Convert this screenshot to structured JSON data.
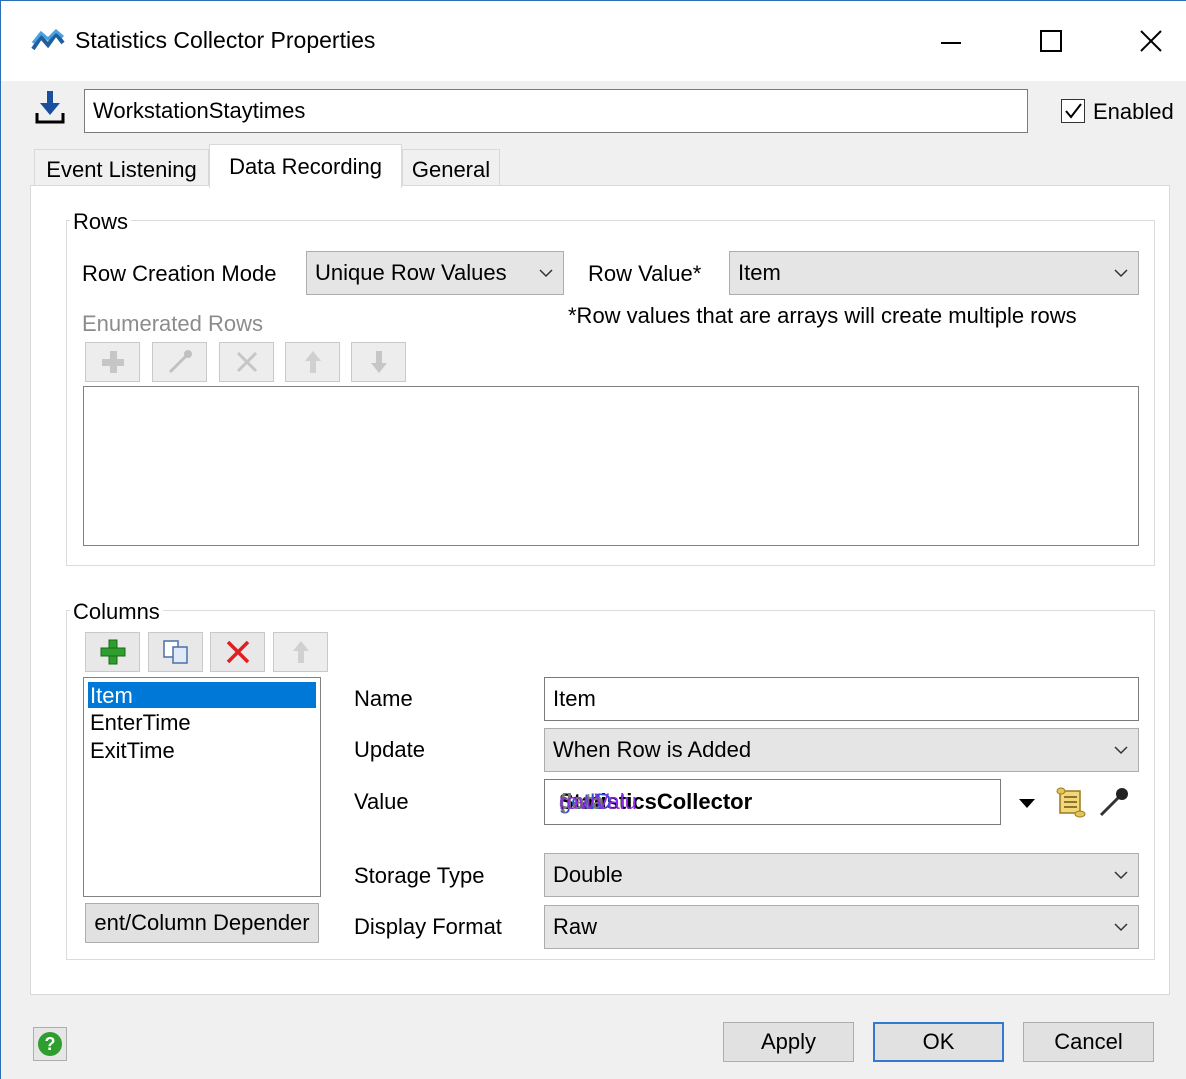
{
  "window": {
    "title": "Statistics Collector Properties",
    "minimize_icon": "minimize-icon",
    "maximize_icon": "maximize-icon",
    "close_icon": "close-icon"
  },
  "header": {
    "object_name": "WorkstationStaytimes",
    "enabled_label": "Enabled",
    "enabled_checked": true
  },
  "tabs": [
    {
      "label": "Event Listening",
      "active": false
    },
    {
      "label": "Data Recording",
      "active": true
    },
    {
      "label": "General",
      "active": false
    }
  ],
  "rows_group": {
    "legend": "Rows",
    "row_creation_mode_label": "Row Creation Mode",
    "row_creation_mode_value": "Unique Row Values",
    "row_value_label": "Row Value*",
    "row_value_value": "Item",
    "note": "*Row values that are arrays will create multiple rows",
    "enumerated_rows_label": "Enumerated Rows"
  },
  "columns_group": {
    "legend": "Columns",
    "columns": [
      "Item",
      "EnterTime",
      "ExitTime"
    ],
    "selected_index": 0,
    "dependencies_button": "ent/Column Depender",
    "name_label": "Name",
    "name_value": "Item",
    "update_label": "Update",
    "update_value": "When Row is Added",
    "value_label": "Value",
    "value_code": {
      "part1": "StatisticsCollector",
      "part2": ".",
      "part3": "getID",
      "part4": "(",
      "part5": "data",
      "part6": ".",
      "part7": "rowValu"
    },
    "storage_type_label": "Storage Type",
    "storage_type_value": "Double",
    "display_format_label": "Display Format",
    "display_format_value": "Raw"
  },
  "footer": {
    "apply": "Apply",
    "ok": "OK",
    "cancel": "Cancel"
  },
  "colors": {
    "accent": "#2f7bd0",
    "selection": "#0078d7",
    "green": "#2e9e2e",
    "red": "#e02020"
  }
}
